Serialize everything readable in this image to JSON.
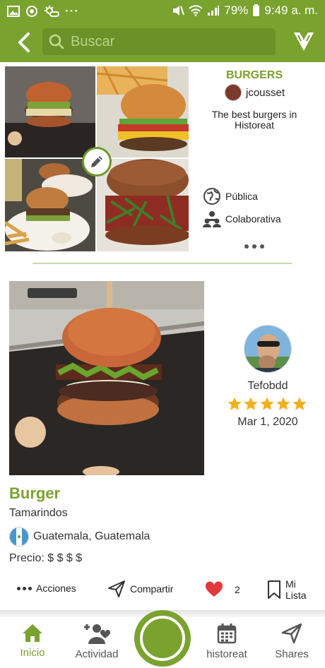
{
  "status_bar": {
    "battery": "79%",
    "time": "9:49 a. m."
  },
  "app_bar": {
    "search_placeholder": "Buscar"
  },
  "list": {
    "title": "BURGERS",
    "owner": "jcousset",
    "description": "The best burgers in Historeat",
    "properties": [
      {
        "icon": "globe-icon",
        "label": "Pública"
      },
      {
        "icon": "users-icon",
        "label": "Colaborativa"
      }
    ]
  },
  "post": {
    "user_name": "Tefobdd",
    "rating": 5,
    "date": "Mar 1, 2020",
    "dish": "Burger",
    "restaurant": "Tamarindos",
    "location": "Guatemala, Guatemala",
    "price": "Precio: $ $ $ $",
    "actions": {
      "more_label": "Acciones",
      "share_label": "Compartir",
      "likes": "2",
      "list_label_1": "Mi",
      "list_label_2": "Lista"
    }
  },
  "bottom_nav": [
    {
      "label": "Inicio",
      "active": true
    },
    {
      "label": "Actividad",
      "active": false
    },
    {
      "label": "historeat",
      "active": false
    },
    {
      "label": "Shares",
      "active": false
    }
  ],
  "colors": {
    "brand": "#7aa22f",
    "like": "#e0393e",
    "star": "#f2b01e"
  }
}
